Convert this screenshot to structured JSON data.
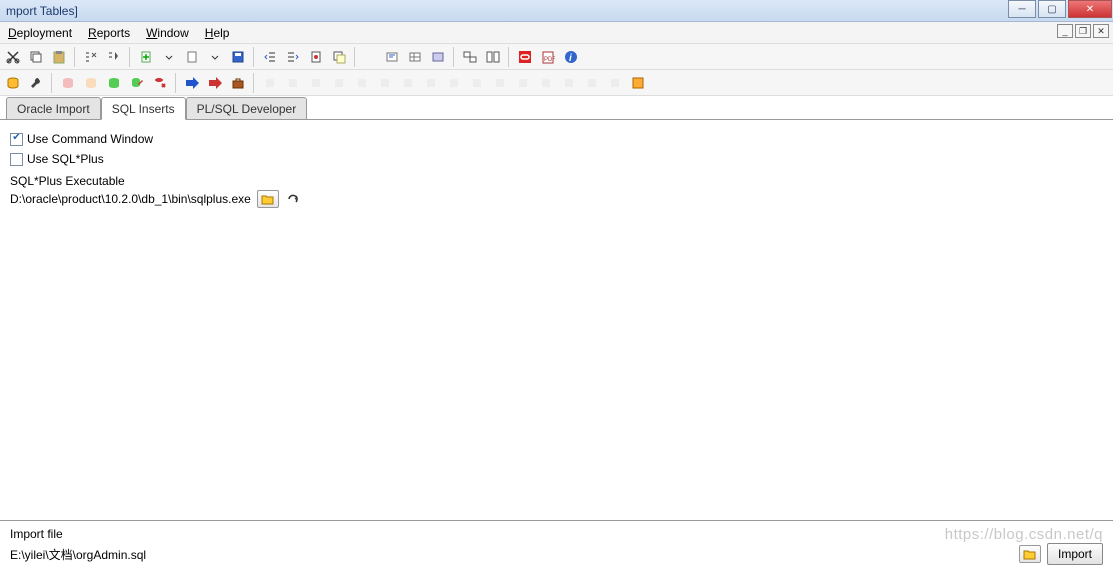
{
  "window": {
    "title": "mport Tables]"
  },
  "menu": {
    "deployment": "Deployment",
    "reports": "Reports",
    "window": "Window",
    "help": "Help"
  },
  "tabs": {
    "oracle_import": "Oracle Import",
    "sql_inserts": "SQL Inserts",
    "plsql_developer": "PL/SQL Developer"
  },
  "options": {
    "use_command_window": "Use Command Window",
    "use_sqlplus": "Use SQL*Plus",
    "sqlplus_executable_label": "SQL*Plus Executable",
    "sqlplus_executable_path": "D:\\oracle\\product\\10.2.0\\db_1\\bin\\sqlplus.exe"
  },
  "import": {
    "label": "Import file",
    "path": "E:\\yilei\\文档\\orgAdmin.sql",
    "button": "Import"
  },
  "watermark": "https://blog.csdn.net/q"
}
